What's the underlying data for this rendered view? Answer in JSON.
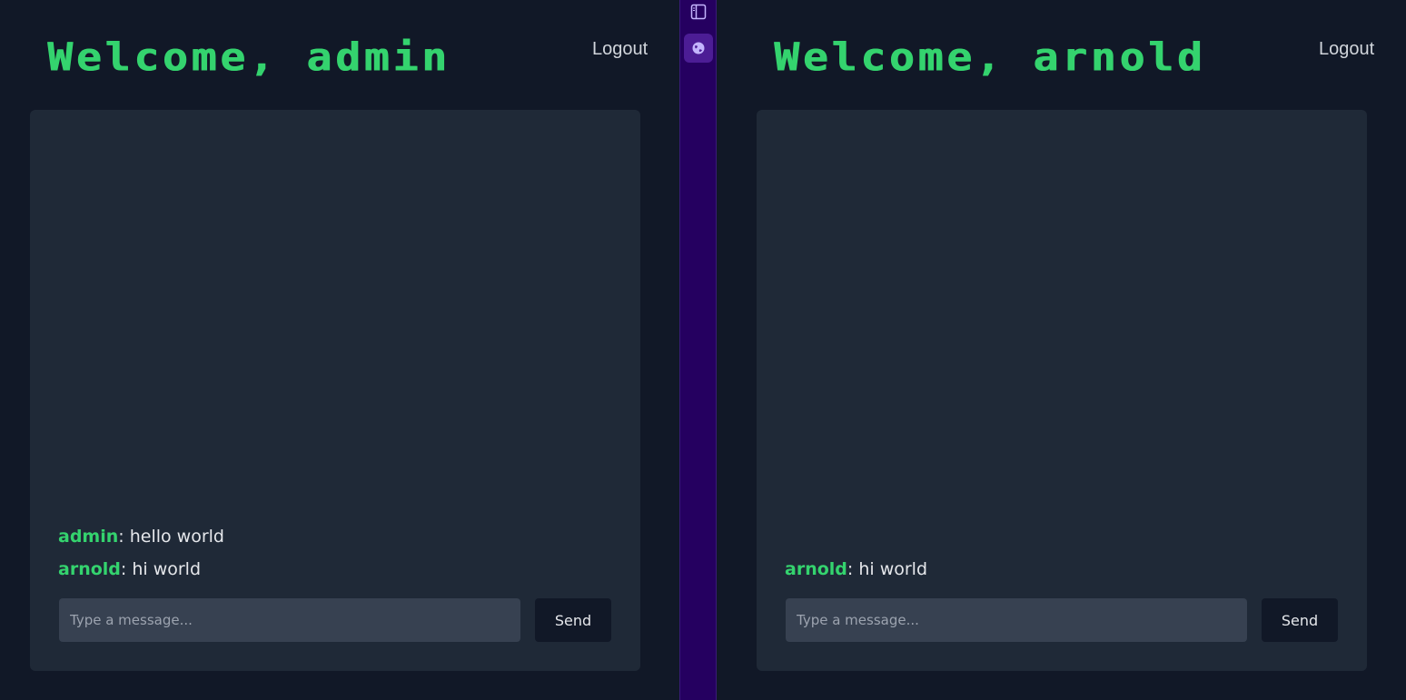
{
  "panes": [
    {
      "title": "Welcome, admin",
      "logout_label": "Logout",
      "messages": [
        {
          "author": "admin",
          "text": ": hello world"
        },
        {
          "author": "arnold",
          "text": ": hi world"
        }
      ],
      "input_placeholder": "Type a message...",
      "send_label": "Send"
    },
    {
      "title": "Welcome, arnold",
      "logout_label": "Logout",
      "messages": [
        {
          "author": "arnold",
          "text": ": hi world"
        }
      ],
      "input_placeholder": "Type a message...",
      "send_label": "Send"
    }
  ],
  "splitter": {
    "icons": [
      "sidebar-toggle-icon",
      "globe-icon"
    ]
  },
  "colors": {
    "background": "#111827",
    "card": "#1f2937",
    "accent_green": "#34d36e",
    "input_bg": "#374151",
    "splitter_bg": "#250060",
    "splitter_active": "#4c1d95"
  }
}
